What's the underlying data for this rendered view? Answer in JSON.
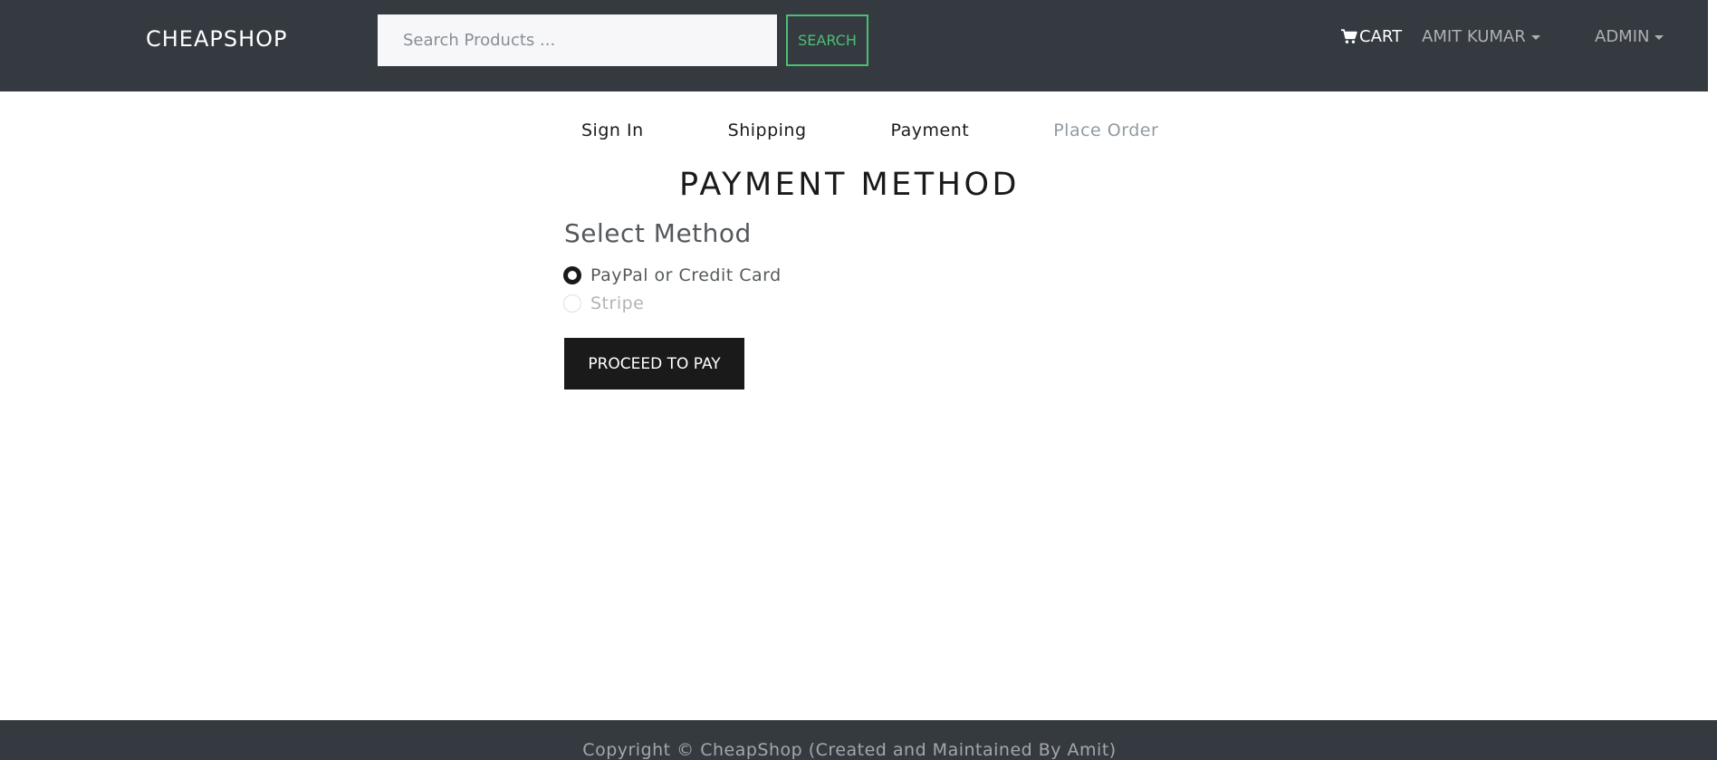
{
  "navbar": {
    "brand": "CHEAPSHOP",
    "search": {
      "placeholder": "Search Products ...",
      "value": "",
      "button_label": "SEARCH"
    },
    "cart_icon": "cart-icon",
    "cart_label": "CART",
    "user_menu_label": "AMIT KUMAR",
    "admin_menu_label": "ADMIN"
  },
  "steps": [
    {
      "label": "Sign In",
      "enabled": true
    },
    {
      "label": "Shipping",
      "enabled": true
    },
    {
      "label": "Payment",
      "enabled": true
    },
    {
      "label": "Place Order",
      "enabled": false
    }
  ],
  "main": {
    "title": "PAYMENT METHOD",
    "legend": "Select Method",
    "options": [
      {
        "label": "PayPal or Credit Card",
        "checked": true,
        "disabled": false
      },
      {
        "label": "Stripe",
        "checked": false,
        "disabled": true
      }
    ],
    "submit_label": "PROCEED TO PAY"
  },
  "footer": {
    "copyright": "Copyright © CheapShop (Created and Maintained By Amit)"
  },
  "colors": {
    "navbar_bg": "#343a40",
    "accent_green": "#4bbf73",
    "primary_dark": "#1a1a1a"
  }
}
